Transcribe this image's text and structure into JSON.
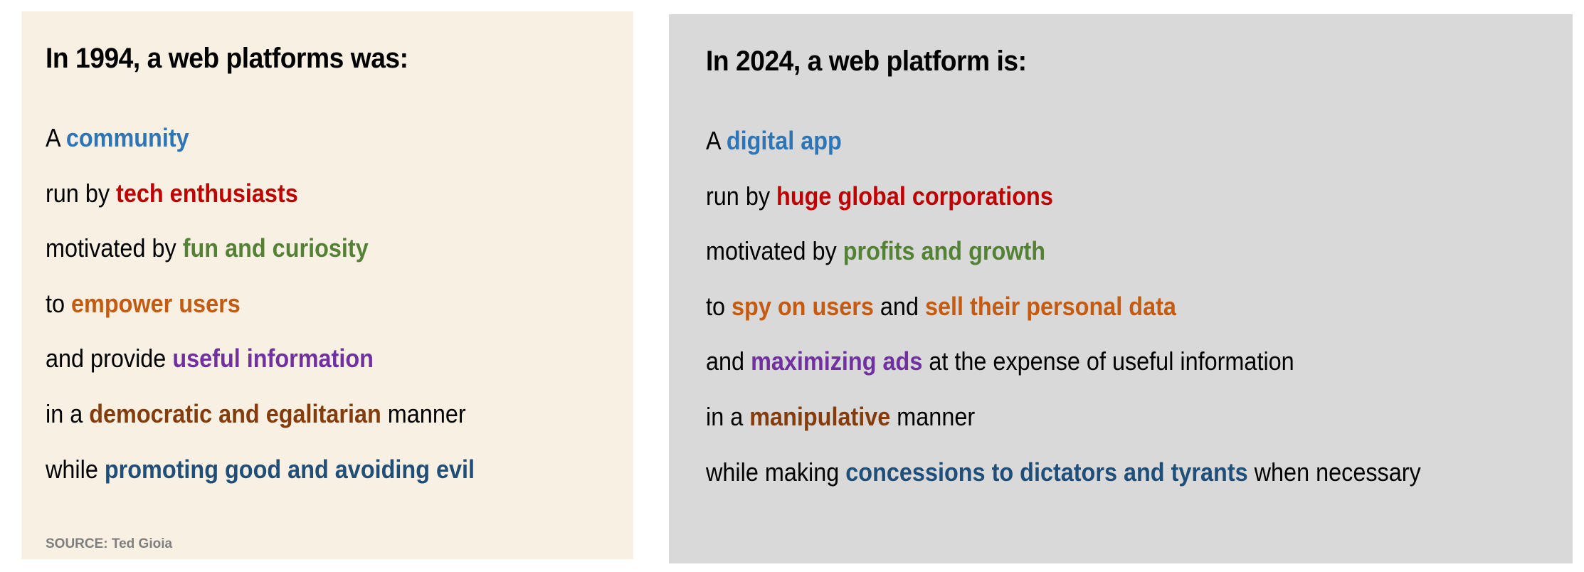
{
  "colors": {
    "left_panel_bg": "#f7f0e3",
    "right_panel_bg": "#d9d9d9",
    "blue": "#2e75b6",
    "red": "#c00000",
    "green": "#548235",
    "orange": "#c55a11",
    "purple": "#7030a0",
    "brown": "#843c0c",
    "dark_blue": "#1f4e79"
  },
  "left": {
    "title": "In 1994, a web platforms was:",
    "lines": [
      [
        {
          "t": "A "
        },
        {
          "t": "community",
          "c": "blue"
        }
      ],
      [
        {
          "t": "run by "
        },
        {
          "t": "tech enthusiasts",
          "c": "red"
        }
      ],
      [
        {
          "t": "motivated by "
        },
        {
          "t": "fun and curiosity",
          "c": "green"
        }
      ],
      [
        {
          "t": "to "
        },
        {
          "t": "empower users",
          "c": "orange"
        }
      ],
      [
        {
          "t": "and provide "
        },
        {
          "t": "useful information",
          "c": "purple"
        }
      ],
      [
        {
          "t": "in a "
        },
        {
          "t": "democratic and egalitarian",
          "c": "brown"
        },
        {
          "t": " manner"
        }
      ],
      [
        {
          "t": "while "
        },
        {
          "t": "promoting good and avoiding evil",
          "c": "dark_blue"
        }
      ]
    ],
    "source": "SOURCE: Ted Gioia"
  },
  "right": {
    "title": "In 2024, a web platform is:",
    "lines": [
      [
        {
          "t": "A "
        },
        {
          "t": "digital app",
          "c": "blue"
        }
      ],
      [
        {
          "t": "run by "
        },
        {
          "t": "huge global corporations",
          "c": "red"
        }
      ],
      [
        {
          "t": "motivated by "
        },
        {
          "t": "profits and growth",
          "c": "green"
        }
      ],
      [
        {
          "t": "to "
        },
        {
          "t": "spy on users",
          "c": "orange"
        },
        {
          "t": " and "
        },
        {
          "t": "sell their personal data",
          "c": "orange"
        }
      ],
      [
        {
          "t": "and "
        },
        {
          "t": "maximizing ads",
          "c": "purple"
        },
        {
          "t": " at the expense of useful information"
        }
      ],
      [
        {
          "t": "in a "
        },
        {
          "t": "manipulative",
          "c": "brown"
        },
        {
          "t": " manner"
        }
      ],
      [
        {
          "t": "while making "
        },
        {
          "t": "concessions to dictators and tyrants",
          "c": "dark_blue"
        },
        {
          "t": " when necessary"
        }
      ]
    ]
  }
}
